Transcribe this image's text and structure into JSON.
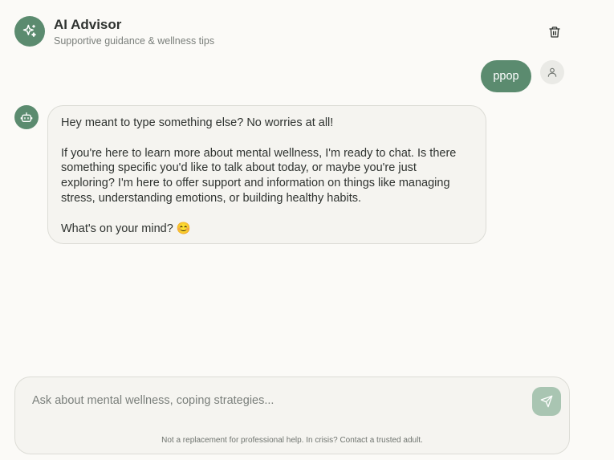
{
  "header": {
    "title": "AI Advisor",
    "subtitle": "Supportive guidance & wellness tips",
    "logo_icon": "sparkles-icon",
    "delete_icon": "trash-icon"
  },
  "messages": [
    {
      "role": "user",
      "text": "ppop",
      "avatar_icon": "user-icon"
    },
    {
      "role": "assistant",
      "avatar_icon": "bot-icon",
      "paragraphs": [
        "Hey meant to type something else? No worries at all!",
        "If you're here to learn more about mental wellness, I'm ready to chat. Is there something specific you'd like to talk about today, or maybe you're just exploring? I'm here to offer support and information on things like managing stress, understanding emotions, or building healthy habits.",
        "What's on your mind? 😊"
      ]
    }
  ],
  "composer": {
    "value": "",
    "placeholder": "Ask about mental wellness, coping strategies...",
    "send_icon": "send-icon",
    "disclaimer": "Not a replacement for professional help. In crisis? Contact a trusted adult."
  },
  "colors": {
    "accent": "#5b8b6f",
    "send_button_disabled": "#a9c5b2",
    "background": "#fbfaf7",
    "bubble": "#f5f4f0"
  }
}
